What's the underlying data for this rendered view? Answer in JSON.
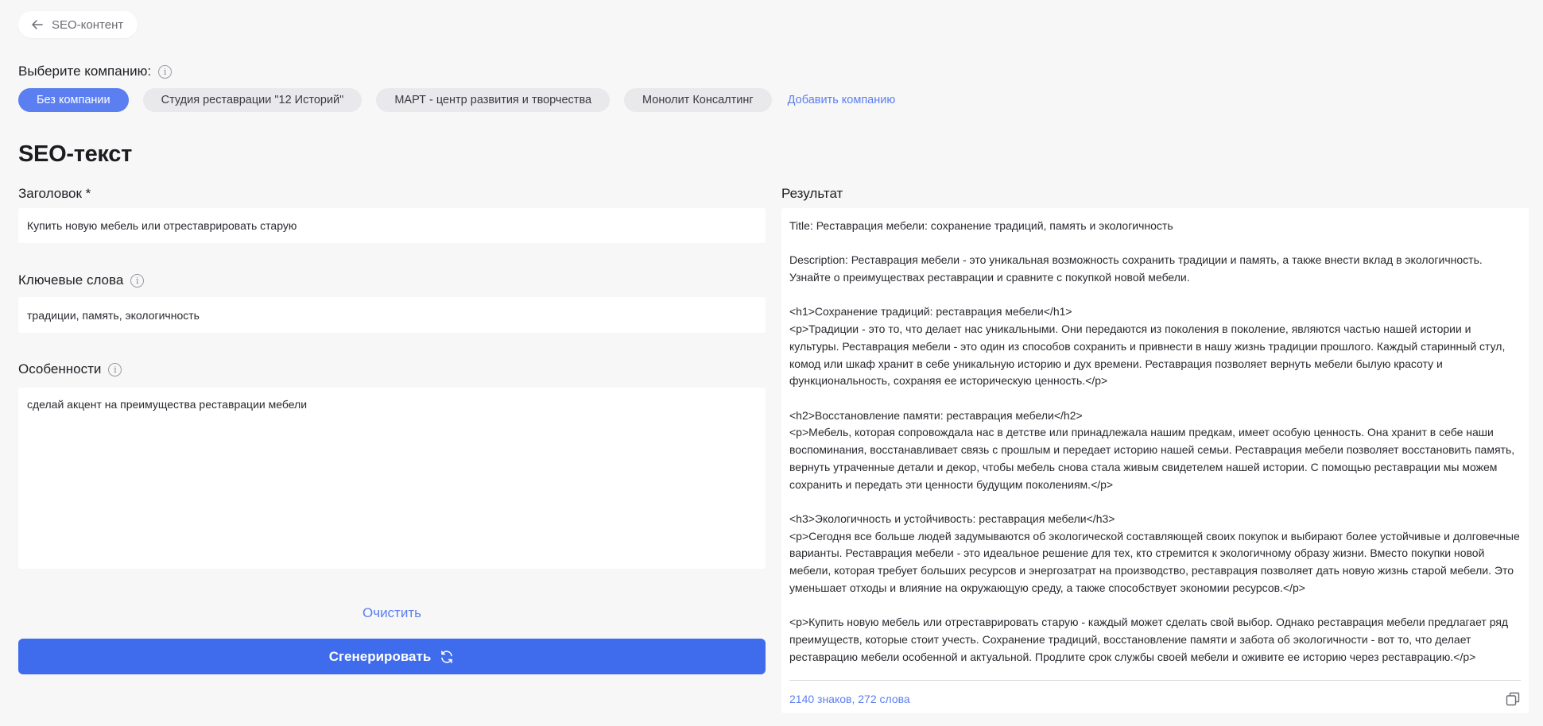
{
  "nav": {
    "back_label": "SEO-контент"
  },
  "company": {
    "label": "Выберите компанию:",
    "options": [
      {
        "label": "Без компании"
      },
      {
        "label": "Студия реставрации \"12 Историй\""
      },
      {
        "label": "МАРТ - центр развития и творчества"
      },
      {
        "label": "Монолит Консалтинг"
      }
    ],
    "selected_index": 0,
    "add_label": "Добавить компанию"
  },
  "page": {
    "title": "SEO-текст"
  },
  "form": {
    "title_label": "Заголовок *",
    "title_value": "Купить новую мебель или отреставрировать старую",
    "keywords_label": "Ключевые слова",
    "keywords_value": "традиции, память, экологичность",
    "features_label": "Особенности",
    "features_value": "сделай акцент на преимущества реставрации мебели",
    "clear_label": "Очистить",
    "generate_label": "Сгенерировать"
  },
  "result": {
    "label": "Результат",
    "paragraphs": [
      "Title: Реставрация мебели: сохранение традиций, память и экологичность",
      "Description: Реставрация мебели - это уникальная возможность сохранить традиции и память, а также внести вклад в экологичность. Узнайте о преимуществах реставрации и сравните с покупкой новой мебели.",
      "<h1>Сохранение традиций: реставрация мебели</h1>\n<p>Традиции - это то, что делает нас уникальными. Они передаются из поколения в поколение, являются частью нашей истории и культуры. Реставрация мебели - это один из способов сохранить и привнести в нашу жизнь традиции прошлого. Каждый старинный стул, комод или шкаф хранит в себе уникальную историю и дух времени. Реставрация позволяет вернуть мебели былую красоту и функциональность, сохраняя ее историческую ценность.</p>",
      "<h2>Восстановление памяти: реставрация мебели</h2>\n<p>Мебель, которая сопровождала нас в детстве или принадлежала нашим предкам, имеет особую ценность. Она хранит в себе наши воспоминания, восстанавливает связь с прошлым и передает историю нашей семьи. Реставрация мебели позволяет восстановить память, вернуть утраченные детали и декор, чтобы мебель снова стала живым свидетелем нашей истории. С помощью реставрации мы можем сохранить и передать эти ценности будущим поколениям.</p>",
      "<h3>Экологичность и устойчивость: реставрация мебели</h3>\n<p>Сегодня все больше людей задумываются об экологической составляющей своих покупок и выбирают более устойчивые и долговечные варианты. Реставрация мебели - это идеальное решение для тех, кто стремится к экологичному образу жизни. Вместо покупки новой мебели, которая требует больших ресурсов и энергозатрат на производство, реставрация позволяет дать новую жизнь старой мебели. Это уменьшает отходы и влияние на окружающую среду, а также способствует экономии ресурсов.</p>",
      "<p>Купить новую мебель или отреставрировать старую - каждый может сделать свой выбор. Однако реставрация мебели предлагает ряд преимуществ, которые стоит учесть. Сохранение традиций, восстановление памяти и забота об экологичности - вот то, что делает реставрацию мебели особенной и актуальной. Продлите срок службы своей мебели и оживите ее историю через реставрацию.</p>"
    ],
    "counter": "2140 знаков, 272 слова"
  },
  "icons": {
    "back": "arrow-left-icon",
    "info": "info-icon",
    "generate": "refresh-icon",
    "copy": "copy-icon"
  },
  "colors": {
    "accent": "#5b7ef0",
    "primary_button": "#3f6cec",
    "background": "#f7f7f8"
  }
}
